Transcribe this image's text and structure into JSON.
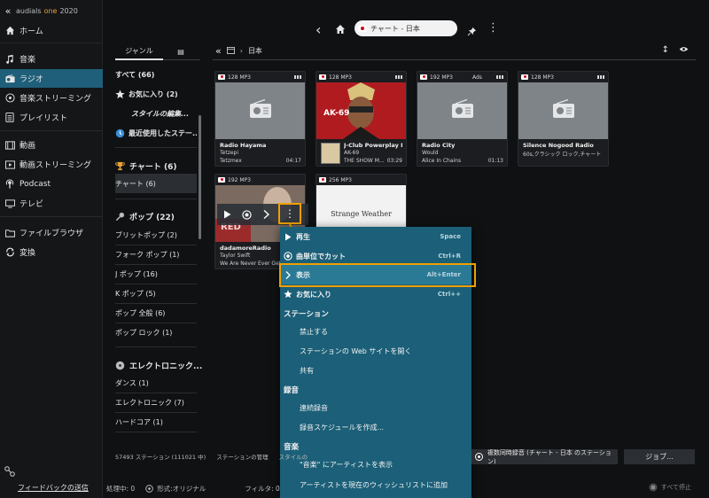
{
  "app": {
    "collapse_glyph": "«",
    "brand": "audials",
    "brand_accent": "one",
    "brand_year": "2020"
  },
  "nav": {
    "items": [
      {
        "label": "ホーム",
        "icon": "home-icon"
      },
      {
        "label": "音楽",
        "icon": "music-note-icon"
      },
      {
        "label": "ラジオ",
        "icon": "radio-icon",
        "active": true
      },
      {
        "label": "音楽ストリーミング",
        "icon": "music-streaming-icon"
      },
      {
        "label": "プレイリスト",
        "icon": "playlist-icon"
      },
      {
        "label": "動画",
        "icon": "film-icon"
      },
      {
        "label": "動画ストリーミング",
        "icon": "video-streaming-icon"
      },
      {
        "label": "Podcast",
        "icon": "podcast-icon"
      },
      {
        "label": "テレビ",
        "icon": "tv-icon"
      },
      {
        "label": "ファイルブラウザ",
        "icon": "folder-icon"
      },
      {
        "label": "変換",
        "icon": "convert-icon"
      }
    ],
    "feedback": "フィードバックの送信"
  },
  "topbar": {
    "address": "チャート - 日本"
  },
  "genre": {
    "tabs": [
      "ジャンル",
      "▤"
    ],
    "all": "すべて (66)",
    "favorites": "お気に入り (2)",
    "style_edit": "スタイルの編集...",
    "recent": "最近使用したステー...",
    "chart_head": "チャート (6)",
    "chart_item": "チャート (6)",
    "pop_head": "ポップ (22)",
    "pop_items": [
      "ブリットポップ (2)",
      "フォーク ポップ (1)",
      "J ポップ (16)",
      "K ポップ (5)",
      "ポップ 全般 (6)",
      "ポップ ロック (1)"
    ],
    "electronic_head": "エレクトロニック...",
    "electronic_items": [
      "ダンス (1)",
      "エレクトロニック (7)",
      "ハードコア (1)"
    ]
  },
  "content": {
    "back": "«",
    "separator": "›",
    "breadcrumb": "日本"
  },
  "tiles": [
    {
      "meta": "128 MP3",
      "ads": "",
      "name": "Radio Hayama",
      "line2": "Tetzepi",
      "line3": "Tetzmex",
      "duration": "04:17",
      "art": "placeholder"
    },
    {
      "meta": "128 MP3",
      "ads": "",
      "name": "J-Club Powerplay Hi...",
      "line2": "AK-69",
      "line3": "THE SHOW M...",
      "duration": "03:29",
      "art": "cover",
      "cover_text": "AK-69"
    },
    {
      "meta": "192 MP3",
      "ads": "Ads",
      "name": "Radio City",
      "line2": "Would",
      "line3": "Alice In Chains",
      "duration": "01:13",
      "art": "placeholder"
    },
    {
      "meta": "128 MP3",
      "ads": "",
      "name": "Silence Nogood Radio",
      "line2": "60s,クラシック ロック,チャート",
      "line3": "",
      "duration": "",
      "art": "placeholder"
    },
    {
      "meta": "192 MP3",
      "ads": "",
      "name": "dadamoreRadio",
      "line2": "Taylor Swift",
      "line3": "We Are Never Ever Gett...",
      "duration": "",
      "art": "cover2",
      "cover_text": "RED"
    },
    {
      "meta": "256 MP3",
      "ads": "",
      "name": "",
      "line2": "",
      "line3": "",
      "duration": "",
      "art": "cover3",
      "cover_text": "Strange Weather"
    }
  ],
  "context_menu": {
    "play": {
      "label": "再生",
      "shortcut": "Space"
    },
    "cut": {
      "label": "曲単位でカット",
      "shortcut": "Ctrl+R"
    },
    "show": {
      "label": "表示",
      "shortcut": "Alt+Enter"
    },
    "favorite": {
      "label": "お気に入り",
      "shortcut": "Ctrl++"
    },
    "station_head": "ステーション",
    "ban": "禁止する",
    "open_web": "ステーションの Web サイトを開く",
    "share": "共有",
    "record_head": "録音",
    "continuous": "連続録音",
    "schedule": "録音スケジュールを作成...",
    "music_head": "音楽",
    "show_artist": "\"音楽\" にアーティストを表示",
    "add_wishlist": "アーティストを現在のウィッシュリストに追加"
  },
  "status": {
    "stations": "57493 ステーション (111021 中)",
    "manage": "ステーションの管理",
    "style": "スタイルの",
    "multi_record": "複数同時録音 (チャート - 日本 のステーション)",
    "jobs": "ジョブ...",
    "processing": "処理中: 0",
    "format": "形式:オリジナル",
    "filter": "フィルタ: 0",
    "stop_all": "すべて停止"
  },
  "colors": {
    "accent_active": "#1f5f7a",
    "menu_bg": "#1b5f78",
    "highlight": "#f0a000",
    "brand_accent": "#e8a13a"
  }
}
